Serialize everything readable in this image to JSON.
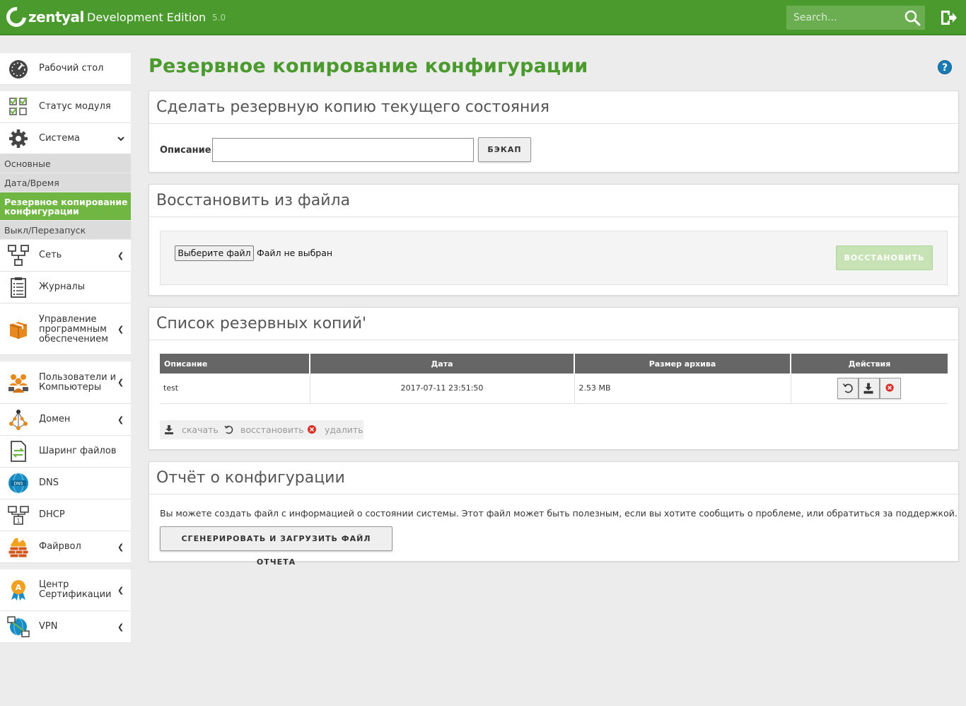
{
  "header": {
    "logo_text": "zentyal",
    "edition": "Development Edition",
    "version": "5.0",
    "search_placeholder": "Search..."
  },
  "sidebar": {
    "dashboard": "Рабочий стол",
    "module_status": "Статус модуля",
    "system": "Система",
    "system_sub": {
      "general": "Основные",
      "datetime": "Дата/Время",
      "backup": "Резервное копирование конфигурации",
      "shutdown": "Выкл/Перезапуск"
    },
    "network": "Сеть",
    "logs": "Журналы",
    "software": "Управление программным обеспечением",
    "users": "Пользователи и Компьютеры",
    "domain": "Домен",
    "file_sharing": "Шаринг файлов",
    "dns": "DNS",
    "dhcp": "DHCP",
    "firewall": "Файрвол",
    "ca": "Центр Сертификации",
    "vpn": "VPN"
  },
  "page": {
    "title": "Резервное копирование конфигурации",
    "help": "?"
  },
  "backup_panel": {
    "title": "Сделать резервную копию текущего состояния",
    "description_label": "Описание",
    "description_value": "",
    "button": "БЭКАП"
  },
  "restore_panel": {
    "title": "Восстановить из файла",
    "file_button": "Выберите файл",
    "file_status": "Файл не выбран",
    "button": "ВОССТАНОВИТЬ"
  },
  "list_panel": {
    "title": "Список резервных копий'",
    "columns": [
      "Описание",
      "Дата",
      "Размер архива",
      "Действия"
    ],
    "rows": [
      {
        "description": "test",
        "date": "2017-07-11 23:51:50",
        "size": "2.53 MB"
      }
    ],
    "legend": {
      "download": "скачать",
      "restore": "восстановить",
      "delete": "удалить"
    }
  },
  "report_panel": {
    "title": "Отчёт о конфигурации",
    "text": "Вы можете создать файл с информацией о состоянии системы. Этот файл может быть полезным, если вы хотите сообщить о проблеме, или обратиться за поддержкой.",
    "button": "СГЕНЕРИРОВАТЬ И ЗАГРУЗИТЬ ФАЙЛ ОТЧЕТА"
  },
  "colors": {
    "brand_green": "#4a9a2e",
    "active_green": "#6fb742",
    "table_header": "#666666"
  }
}
